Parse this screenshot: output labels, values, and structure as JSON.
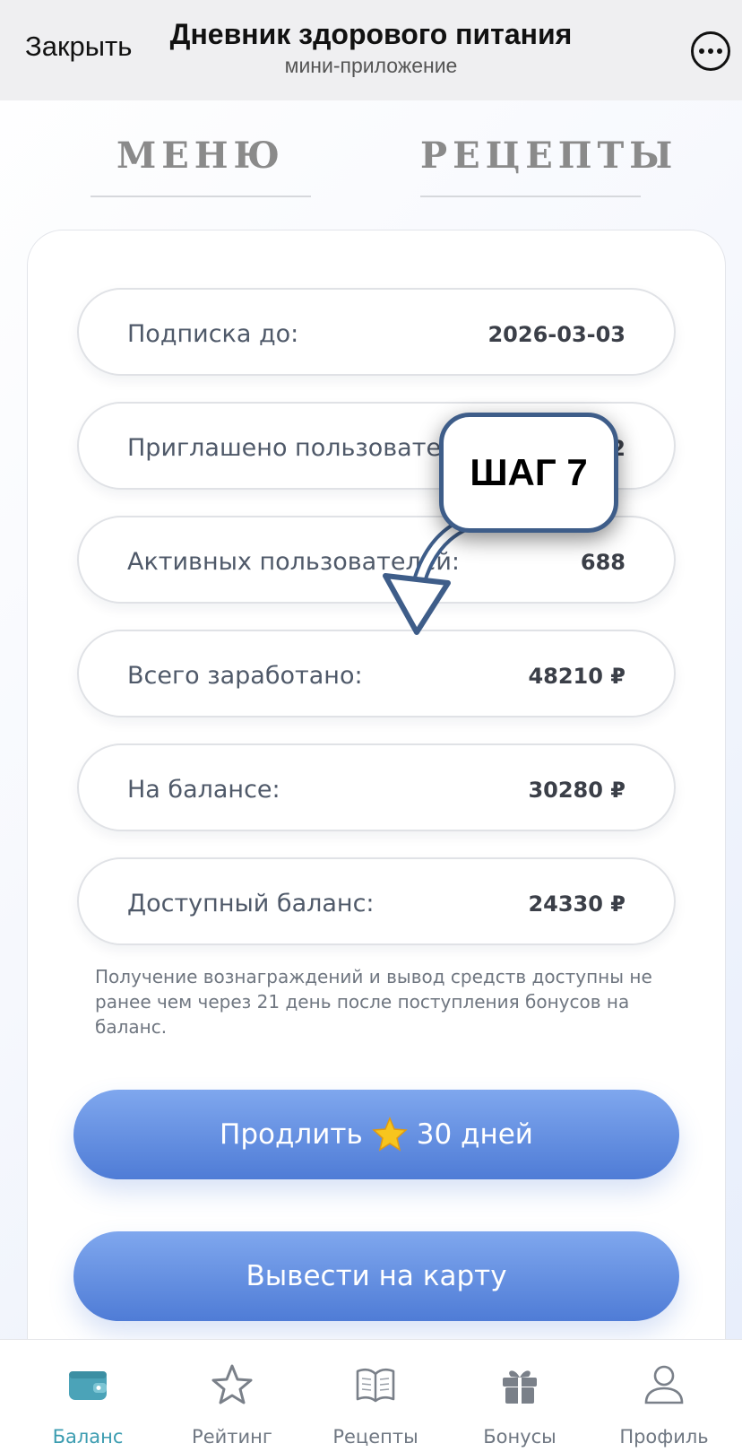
{
  "header": {
    "close_label": "Закрыть",
    "title": "Дневник здорового питания",
    "subtitle": "мини-приложение",
    "more_icon": "ellipsis-icon"
  },
  "tabs": [
    {
      "label": "МЕНЮ"
    },
    {
      "label": "РЕЦЕПТЫ"
    }
  ],
  "stats": [
    {
      "label": "Подписка до:",
      "value": "2026-03-03"
    },
    {
      "label": "Приглашено пользователей:",
      "value": "2"
    },
    {
      "label": "Активных пользователей:",
      "value": "688"
    },
    {
      "label": "Всего заработано:",
      "value": "48210 ₽"
    },
    {
      "label": "На балансе:",
      "value": "30280 ₽"
    },
    {
      "label": "Доступный баланс:",
      "value": "24330 ₽"
    }
  ],
  "note": "Получение вознаграждений и вывод средств доступны не ранее чем через 21 день после поступления бонусов на баланс.",
  "buttons": {
    "extend_prefix": "Продлить",
    "extend_suffix": "30 дней",
    "withdraw": "Вывести на карту"
  },
  "overlay": {
    "step_label": "ШАГ 7"
  },
  "nav": [
    {
      "label": "Баланс",
      "icon": "wallet-icon"
    },
    {
      "label": "Рейтинг",
      "icon": "star-icon"
    },
    {
      "label": "Рецепты",
      "icon": "book-icon"
    },
    {
      "label": "Бонусы",
      "icon": "gift-icon"
    },
    {
      "label": "Профиль",
      "icon": "user-icon"
    }
  ],
  "colors": {
    "accent": "#4f7cd6",
    "nav_active": "#3b9cb0",
    "callout_border": "#3e5d89"
  }
}
